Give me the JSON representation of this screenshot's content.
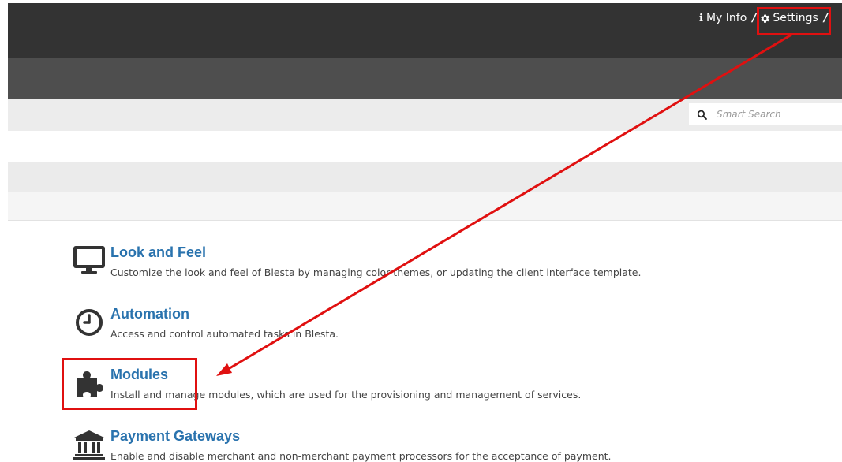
{
  "topnav": {
    "my_info_label": "My Info",
    "settings_label": "Settings",
    "separator": "/"
  },
  "search": {
    "placeholder": "Smart Search"
  },
  "settings_items": [
    {
      "title": "Look and Feel",
      "description": "Customize the look and feel of Blesta by managing color themes, or updating the client interface template.",
      "icon": "monitor-icon"
    },
    {
      "title": "Automation",
      "description": "Access and control automated tasks in Blesta.",
      "icon": "clock-icon"
    },
    {
      "title": "Modules",
      "description": "Install and manage modules, which are used for the provisioning and management of services.",
      "icon": "puzzle-icon"
    },
    {
      "title": "Payment Gateways",
      "description": "Enable and disable merchant and non-merchant payment processors for the acceptance of payment.",
      "icon": "bank-icon"
    }
  ],
  "annotation": {
    "color": "#e01010",
    "highlights": [
      "Settings",
      "Modules"
    ]
  },
  "colors": {
    "topbar": "#333333",
    "subbar": "#4e4e4e",
    "link": "#2a73ae"
  }
}
